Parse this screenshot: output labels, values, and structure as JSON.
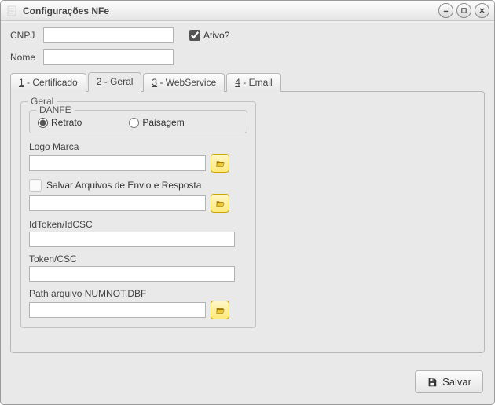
{
  "window": {
    "title": "Configurações NFe"
  },
  "header": {
    "cnpj_label": "CNPJ",
    "cnpj_value": "",
    "ativo_label": "Ativo?",
    "ativo_checked": true,
    "nome_label": "Nome",
    "nome_value": ""
  },
  "tabs": {
    "t1_mn": "1",
    "t1_rest": " - Certificado",
    "t2_mn": "2",
    "t2_rest": " - Geral",
    "t3_mn": "3",
    "t3_rest": " - WebService",
    "t4_mn": "4",
    "t4_rest": " - Email",
    "active_index": 1
  },
  "geral": {
    "group_title": "Geral",
    "danfe": {
      "title": "DANFE",
      "retrato_label": "Retrato",
      "paisagem_label": "Paisagem",
      "retrato_selected": true,
      "paisagem_selected": false
    },
    "logo_label": "Logo Marca",
    "logo_value": "",
    "salvar_arq_label": "Salvar Arquivos de Envio e Resposta",
    "salvar_arq_checked": false,
    "salvar_arq_path": "",
    "idtoken_label": "IdToken/IdCSC",
    "idtoken_value": "",
    "token_label": "Token/CSC",
    "token_value": "",
    "numnot_label": "Path arquivo NUMNOT.DBF",
    "numnot_value": ""
  },
  "footer": {
    "save_label": "Salvar"
  },
  "icons": {
    "minimize": "minimize-icon",
    "maximize": "maximize-icon",
    "close": "close-icon",
    "folder": "folder-open-icon",
    "save": "save-icon"
  }
}
